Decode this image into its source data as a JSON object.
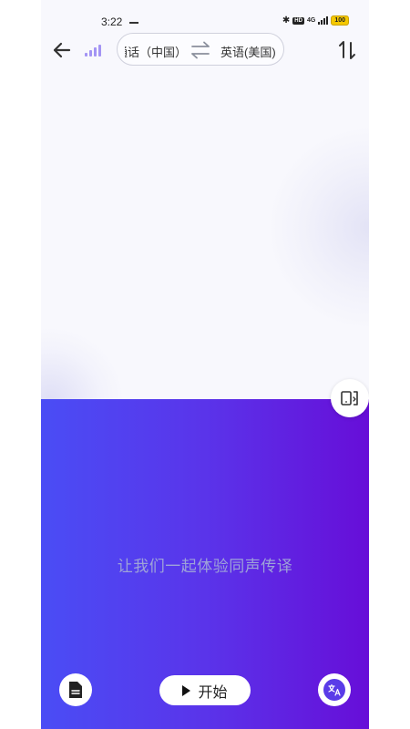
{
  "status_bar": {
    "time": "3:22",
    "network": "4G",
    "hd_badge": "HD",
    "battery": "100"
  },
  "header": {
    "source_language": "普通话（中国）",
    "target_language": "英语(美国)"
  },
  "main": {
    "hint": "让我们一起体验同声传译",
    "start_label": "开始"
  },
  "colors": {
    "accent": "#5a3be8",
    "gradient_start": "#4a4df5",
    "gradient_end": "#670ed8",
    "hint_text": "#9ea3d8",
    "bars_icon": "#a394f4"
  },
  "icons": {
    "back": "arrow-left-icon",
    "signal_bars": "signal-bars-icon",
    "swap": "swap-arrows-icon",
    "sort": "sort-arrows-icon",
    "flip": "split-screen-icon",
    "document": "document-icon",
    "translate": "translate-icon"
  }
}
